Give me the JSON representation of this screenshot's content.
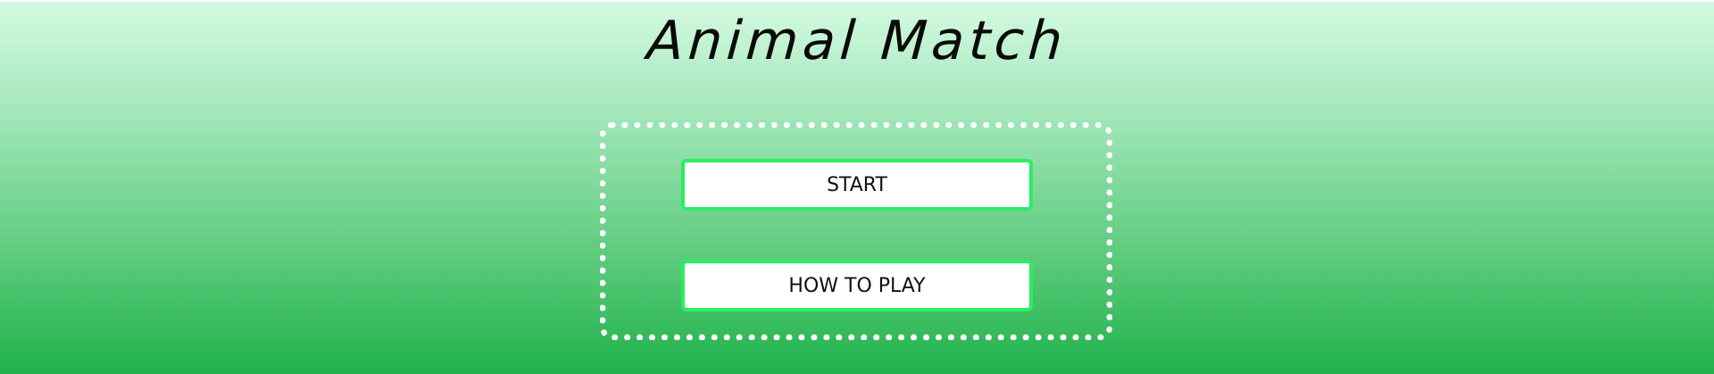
{
  "game": {
    "title": "Animal Match"
  },
  "menu": {
    "start_label": "START",
    "how_to_play_label": "HOW TO PLAY"
  },
  "colors": {
    "background_top": "#d3fae0",
    "background_bottom": "#21b24c",
    "button_border": "#2bee63",
    "menu_border": "#ffffff"
  }
}
